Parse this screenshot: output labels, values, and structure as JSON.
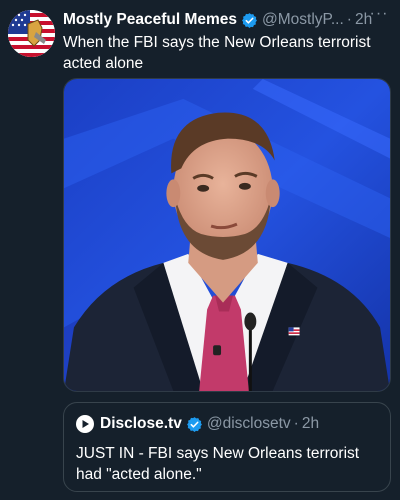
{
  "tweet": {
    "display_name": "Mostly Peaceful Memes",
    "handle": "@MostlyP...",
    "separator": "·",
    "time": "2h",
    "more_label": "···",
    "text": "When the FBI says the New Orleans terrorist acted alone",
    "media_icon": "photo-of-man-in-suit"
  },
  "quote": {
    "display_name": "Disclose.tv",
    "handle": "@disclosetv",
    "separator": "·",
    "time": "2h",
    "text": "JUST IN - FBI says New Orleans terrorist had \"acted alone.\""
  },
  "colors": {
    "background": "#15202b",
    "verified": "#1d9bf0",
    "secondary_text": "#8b98a5",
    "border": "#38444d"
  }
}
